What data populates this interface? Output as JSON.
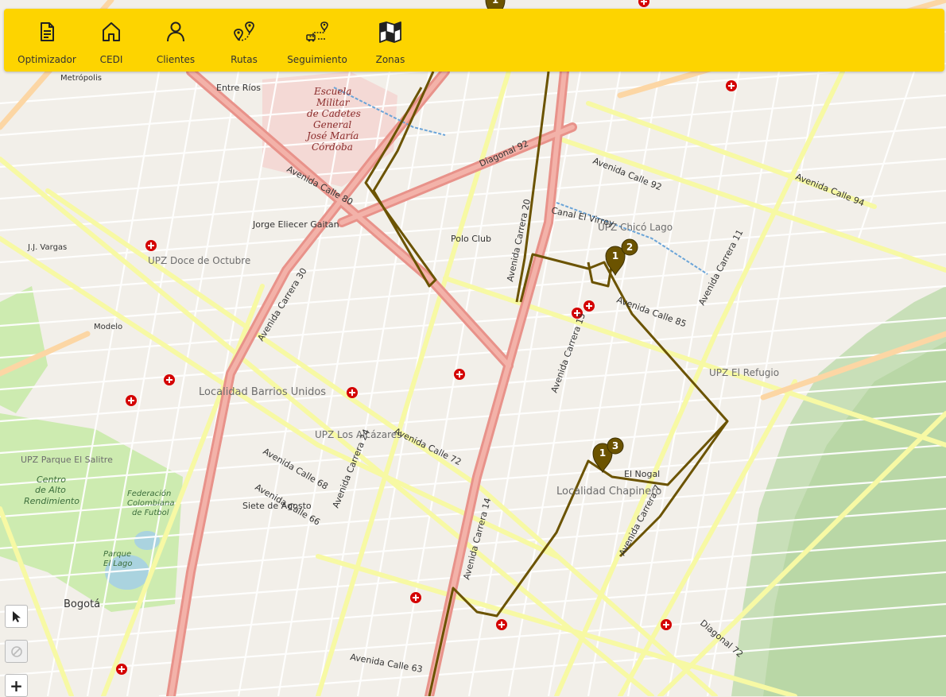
{
  "toolbar": {
    "items": [
      {
        "label": "Optimizador",
        "icon": "document-icon"
      },
      {
        "label": "CEDI",
        "icon": "home-icon"
      },
      {
        "label": "Clientes",
        "icon": "user-icon"
      },
      {
        "label": "Rutas",
        "icon": "route-pins-icon"
      },
      {
        "label": "Seguimiento",
        "icon": "tracking-icon"
      },
      {
        "label": "Zonas",
        "icon": "zone-map-icon"
      }
    ]
  },
  "map": {
    "route_color": "#6b5300",
    "marker_color": "#6b5300",
    "markers": [
      {
        "number": "1",
        "kind": "pin"
      },
      {
        "number": "2",
        "kind": "badge"
      },
      {
        "number": "1",
        "kind": "pin"
      },
      {
        "number": "3",
        "kind": "badge"
      },
      {
        "number": "1",
        "kind": "pin"
      }
    ],
    "labels": {
      "areas": [
        "UPZ Chicó Lago",
        "UPZ Doce de Octubre",
        "Localidad Barrios Unidos",
        "UPZ Los Alcázares",
        "UPZ El Refugio",
        "Localidad Chapinero",
        "UPZ Parque El Salitre",
        "Polo Club",
        "Jorge Eliecer Gaitan",
        "Siete de Agosto",
        "El Nogal",
        "J.J. Vargas",
        "Modelo",
        "Entre Ríos",
        "Metrópolis",
        "Bogotá"
      ],
      "poi": [
        "Escuela",
        "Militar",
        "de Cadetes",
        "General",
        "José María",
        "Córdoba"
      ],
      "parks": [
        "Centro",
        "de Alto",
        "Rendimiento",
        "Federación",
        "Colombiana",
        "de Futbol",
        "Parque",
        "El Lago"
      ],
      "roads": [
        "Avenida Calle 80",
        "Avenida Carrera 30",
        "Avenida Carrera 20",
        "Diagonal 92",
        "Avenida Calle 92",
        "Avenida Calle 94",
        "Avenida Calle 85",
        "Avenida Calle 72",
        "Avenida Calle 68",
        "Avenida Carrera 14",
        "Avenida Carrera 7",
        "Avenida Carrera 11",
        "Avenida Calle 63",
        "Avenida Carrera 24",
        "Avenida Calle 66",
        "Avenida Carrera 15",
        "Canal El Virrey",
        "Diagonal 72"
      ]
    }
  },
  "controls": {
    "zoom_in": "+"
  }
}
